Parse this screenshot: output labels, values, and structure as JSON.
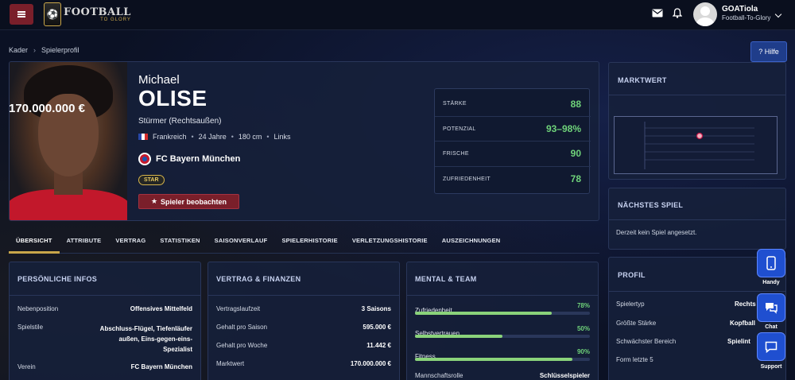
{
  "header": {
    "logo_main": "FOOTBALL",
    "logo_sub": "TO GLORY",
    "user_name": "GOATiola",
    "user_sub": "Football-To-Glory"
  },
  "breadcrumb": {
    "items": [
      "Kader",
      "Spielerprofil"
    ]
  },
  "help_label": "? Hilfe",
  "player": {
    "first_name": "Michael",
    "last_name": "OLISE",
    "position": "Stürmer (Rechtsaußen)",
    "nation": "Frankreich",
    "age": "24 Jahre",
    "height": "180 cm",
    "foot": "Links",
    "club": "FC Bayern München",
    "badge": "STAR",
    "watch_label": "Spieler beobachten"
  },
  "stats": [
    {
      "label": "STÄRKE",
      "value": "88"
    },
    {
      "label": "POTENZIAL",
      "value": "93–98%"
    },
    {
      "label": "FRISCHE",
      "value": "90"
    },
    {
      "label": "ZUFRIEDENHEIT",
      "value": "78"
    }
  ],
  "market_value": {
    "title": "MARKTWERT",
    "value": "170.000.000 €"
  },
  "next_match": {
    "title": "NÄCHSTES SPIEL",
    "text": "Derzeit kein Spiel angesetzt."
  },
  "tabs": [
    "ÜBERSICHT",
    "ATTRIBUTE",
    "VERTRAG",
    "STATISTIKEN",
    "SAISONVERLAUF",
    "SPIELERHISTORIE",
    "VERLETZUNGSHISTORIE",
    "AUSZEICHNUNGEN"
  ],
  "personal": {
    "title": "PERSÖNLICHE INFOS",
    "rows": [
      {
        "k": "Nebenposition",
        "v": "Offensives Mittelfeld"
      },
      {
        "k": "Spielstile",
        "v": "Abschluss-Flügel, Tiefenläufer außen, Eins-gegen-eins-Spezialist"
      },
      {
        "k": "Verein",
        "v": "FC Bayern München"
      }
    ]
  },
  "contract": {
    "title": "VERTRAG & FINANZEN",
    "rows": [
      {
        "k": "Vertragslaufzeit",
        "v": "3 Saisons"
      },
      {
        "k": "Gehalt pro Saison",
        "v": "595.000 €"
      },
      {
        "k": "Gehalt pro Woche",
        "v": "11.442 €"
      },
      {
        "k": "Marktwert",
        "v": "170.000.000 €"
      }
    ]
  },
  "mental": {
    "title": "MENTAL & TEAM",
    "bars": [
      {
        "label": "Zufriedenheit",
        "pct": "78%",
        "value": 0.78
      },
      {
        "label": "Selbstvertrauen",
        "pct": "50%",
        "value": 0.5
      },
      {
        "label": "Fitness",
        "pct": "90%",
        "value": 0.9
      }
    ],
    "role_label": "Mannschaftsrolle",
    "role_value": "Schlüsselspieler"
  },
  "profil": {
    "title": "PROFIL",
    "rows": [
      {
        "k": "Spielertyp",
        "v": "Rechts"
      },
      {
        "k": "Größte Stärke",
        "v": "Kopfball"
      },
      {
        "k": "Schwächster Bereich",
        "v": "Spielint"
      },
      {
        "k": "Form letzte 5",
        "v": ""
      }
    ]
  },
  "fabs": {
    "handy": "Handy",
    "chat": "Chat",
    "support": "Support"
  },
  "colors": {
    "accent_red": "#7a1f2a",
    "accent_gold": "#c9a64a",
    "stat_green": "#6fd37a",
    "fab_blue": "#1f4fd0"
  }
}
